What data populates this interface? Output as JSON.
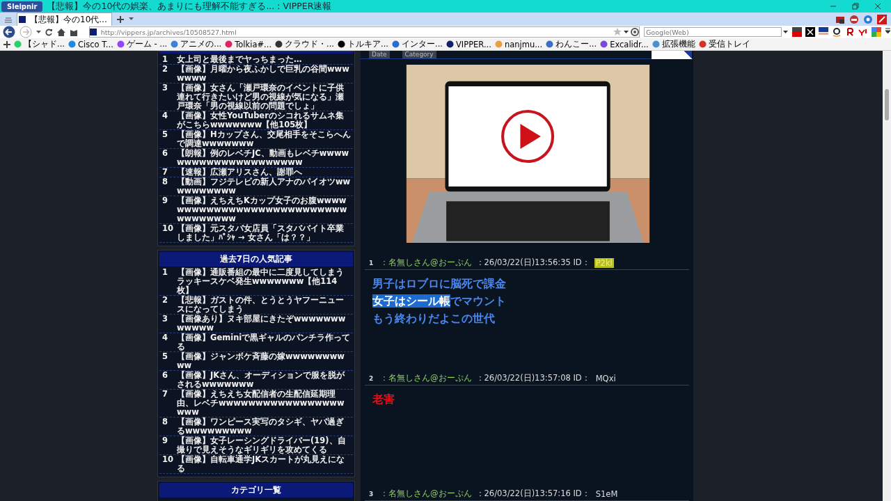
{
  "window": {
    "app_button": "Sleipnir",
    "title": "【悲報】今の10代の娯楽、あまりにも理解不能すぎる... : VIPPER速報"
  },
  "tabs": [
    {
      "label": "【悲報】今の10代...",
      "selected": true
    }
  ],
  "address_bar": {
    "url": "http://vippers.jp/archives/10508527.html"
  },
  "search_field": {
    "placeholder": "Google(Web)"
  },
  "bookmarks": [
    {
      "label": "【シャド..."
    },
    {
      "label": "Cisco T..."
    },
    {
      "label": "ゲーム - ..."
    },
    {
      "label": "アニメの..."
    },
    {
      "label": "Tolkia#..."
    },
    {
      "label": "クラウド・..."
    },
    {
      "label": "トルキア..."
    },
    {
      "label": "インター..."
    },
    {
      "label": "VIPPER..."
    },
    {
      "label": "nanjmu..."
    },
    {
      "label": "わんこー..."
    },
    {
      "label": "Excalidr..."
    },
    {
      "label": "拡張機能"
    },
    {
      "label": "受信トレイ"
    }
  ],
  "sidebar": {
    "ranking": [
      {
        "rank": "1",
        "title": "女上司と最後までヤっちまった…"
      },
      {
        "rank": "2",
        "title": "【画像】月曜から夜ふかしで巨乳の谷間wwwwwww"
      },
      {
        "rank": "3",
        "title": "【画像】女さん「瀬戸環奈のイベントに子供連れて行きたいけど男の視線が気になる」瀬戸環奈「男の視線以前の問題でしょ」"
      },
      {
        "rank": "4",
        "title": "【画像】女性YouTuberのシコれるサムネ集がこちらwwwwwww【他105枚】"
      },
      {
        "rank": "5",
        "title": "【画像】Hカップさん、交尾相手をそこらへんで調達wwwwwww"
      },
      {
        "rank": "6",
        "title": "【朗報】例のレベチJC、動画もレベチwwwwwwwwwwwwwwwwwwwww"
      },
      {
        "rank": "7",
        "title": "【速報】広瀬アリスさん、謝罪へ"
      },
      {
        "rank": "8",
        "title": "【動画】フジテレビの新人アナのパイオツwwwwwwwwww"
      },
      {
        "rank": "9",
        "title": "【画像】えちえちKカップ女子のお腹wwwwwwwwwwwwwwwwwwwwwwwwwwwwwwwwwww"
      },
      {
        "rank": "10",
        "title": "【画像】元スタバ女店員「スタババイト卒業しました」ﾊﾟｼｬ → 女さん「は？？」"
      }
    ],
    "weekly": {
      "heading": "過去7日の人気記事",
      "items": [
        {
          "rank": "1",
          "title": "【画像】通販番組の最中に二度見してしまうラッキースケベ発生wwwwwww【他114枚】"
        },
        {
          "rank": "2",
          "title": "【悲報】ガストの件、とうとうヤフーニュースになってしまう"
        },
        {
          "rank": "3",
          "title": "【画像あり】ヌキ部屋にきたぞwwwwwwwwwwww"
        },
        {
          "rank": "4",
          "title": "【画像】Geminiで黒ギャルのパンチラ作ってる"
        },
        {
          "rank": "5",
          "title": "【画像】ジャンボケ斉藤の嫁wwwwwwwwww"
        },
        {
          "rank": "6",
          "title": "【画像】JKさん、オーディションで服を脱がされるwwwwwww"
        },
        {
          "rank": "7",
          "title": "【画像】えちえち女配信者の生配信延期理由、レベチwwwwwwwwwwwwwwwwwwww"
        },
        {
          "rank": "8",
          "title": "【画像】ワンピース実写のタシギ、ヤバ過ぎるwwwwwwwww"
        },
        {
          "rank": "9",
          "title": "【画像】女子レーシングドライバー(19)、自撮りで見えそうなギリギリを攻めてくる"
        },
        {
          "rank": "10",
          "title": "【画像】自転車通学JKスカートが丸見えになる"
        }
      ]
    },
    "categories": {
      "heading": "カテゴリ一覧"
    }
  },
  "article": {
    "meta": [
      {
        "label": "Date"
      },
      {
        "label": "Category"
      }
    ],
    "posts": [
      {
        "number": "1",
        "name": "：名無しさん@おーぷん",
        "datetime": "：26/03/22(日)13:56:35",
        "id_label": "ID：",
        "id": "P2kl",
        "id_highlighted": true,
        "color": "#4a86ec",
        "lines": [
          [
            {
              "text": "男子はロブロに脳死で課金",
              "selected": false
            }
          ],
          [
            {
              "text": "女子はシール帳",
              "selected": true
            },
            {
              "text": "でマウント",
              "selected": false
            }
          ],
          [
            {
              "text": "もう終わりだよこの世代",
              "selected": false
            }
          ]
        ]
      },
      {
        "number": "2",
        "name": "：名無しさん@おーぷん",
        "datetime": "：26/03/22(日)13:57:08",
        "id_label": "ID：",
        "id": "MQxi",
        "id_highlighted": false,
        "color": "#e0101c",
        "lines": [
          [
            {
              "text": "老害",
              "selected": false
            }
          ]
        ]
      },
      {
        "number": "3",
        "name": "：名無しさん@おーぷん",
        "datetime": "：26/03/22(日)13:57:16",
        "id_label": "ID：",
        "id": "S1eM",
        "id_highlighted": false
      }
    ]
  }
}
